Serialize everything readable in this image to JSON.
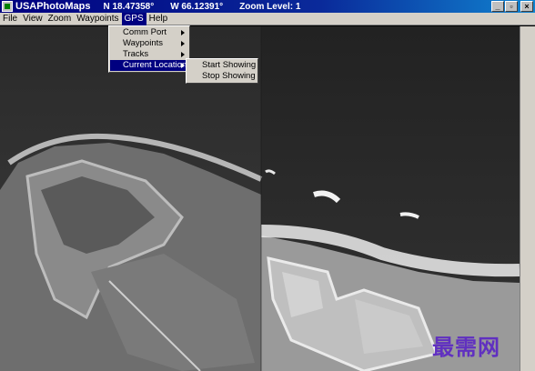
{
  "titlebar": {
    "title": "USAPhotoMaps",
    "latitude": "N 18.47358°",
    "longitude": "W 66.12391°",
    "zoom": "Zoom Level: 1",
    "buttons": {
      "minimize": "_",
      "maximize": "▫",
      "close": "×"
    }
  },
  "menubar": {
    "items": [
      "File",
      "View",
      "Zoom",
      "Waypoints",
      "GPS",
      "Help"
    ]
  },
  "gps_menu": {
    "items": [
      "Comm Port",
      "Waypoints",
      "Tracks",
      "Current Location"
    ]
  },
  "location_submenu": {
    "items": [
      "Start Showing",
      "Stop Showing"
    ]
  },
  "watermark": "最需网"
}
